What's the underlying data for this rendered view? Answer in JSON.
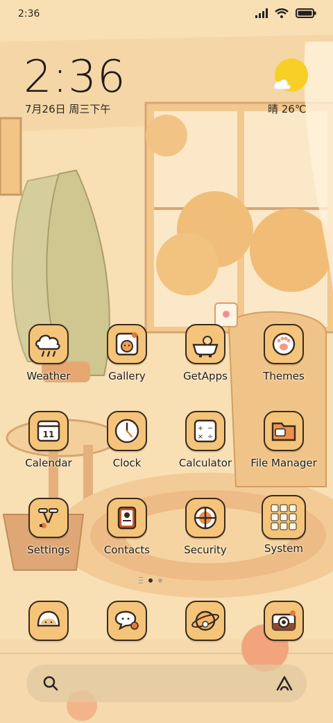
{
  "status_bar": {
    "time": "2:36",
    "icons": [
      "signal-icon",
      "wifi-icon",
      "battery-icon"
    ]
  },
  "clock_widget": {
    "time": "2:36",
    "date": "7月26日 周三下午"
  },
  "weather_widget": {
    "text": "晴 26℃",
    "icon": "sunny-cloud-icon"
  },
  "apps": [
    {
      "label": "Weather",
      "icon": "weather-cloud-icon"
    },
    {
      "label": "Gallery",
      "icon": "gallery-icon"
    },
    {
      "label": "GetApps",
      "icon": "getapps-bathtub-icon"
    },
    {
      "label": "Themes",
      "icon": "paw-icon"
    },
    {
      "label": "Calendar",
      "icon": "calendar-icon",
      "day": "11"
    },
    {
      "label": "Clock",
      "icon": "clock-icon"
    },
    {
      "label": "Calculator",
      "icon": "calculator-icon"
    },
    {
      "label": "File Manager",
      "icon": "folder-icon"
    },
    {
      "label": "Settings",
      "icon": "settings-icon"
    },
    {
      "label": "Contacts",
      "icon": "contacts-icon"
    },
    {
      "label": "Security",
      "icon": "security-icon"
    },
    {
      "label": "System",
      "icon": "system-folder-icon"
    }
  ],
  "page_indicator": {
    "pages": 2,
    "active": 0
  },
  "dock": [
    "phone-bread-icon",
    "messages-icon",
    "browser-planet-icon",
    "camera-icon"
  ],
  "search_bar": {
    "left_icon": "search-icon",
    "right_icon": "assistant-icon"
  },
  "colors": {
    "tile": "#f4c47a",
    "outline": "#3a2a1e",
    "background": "#f7dcae"
  }
}
